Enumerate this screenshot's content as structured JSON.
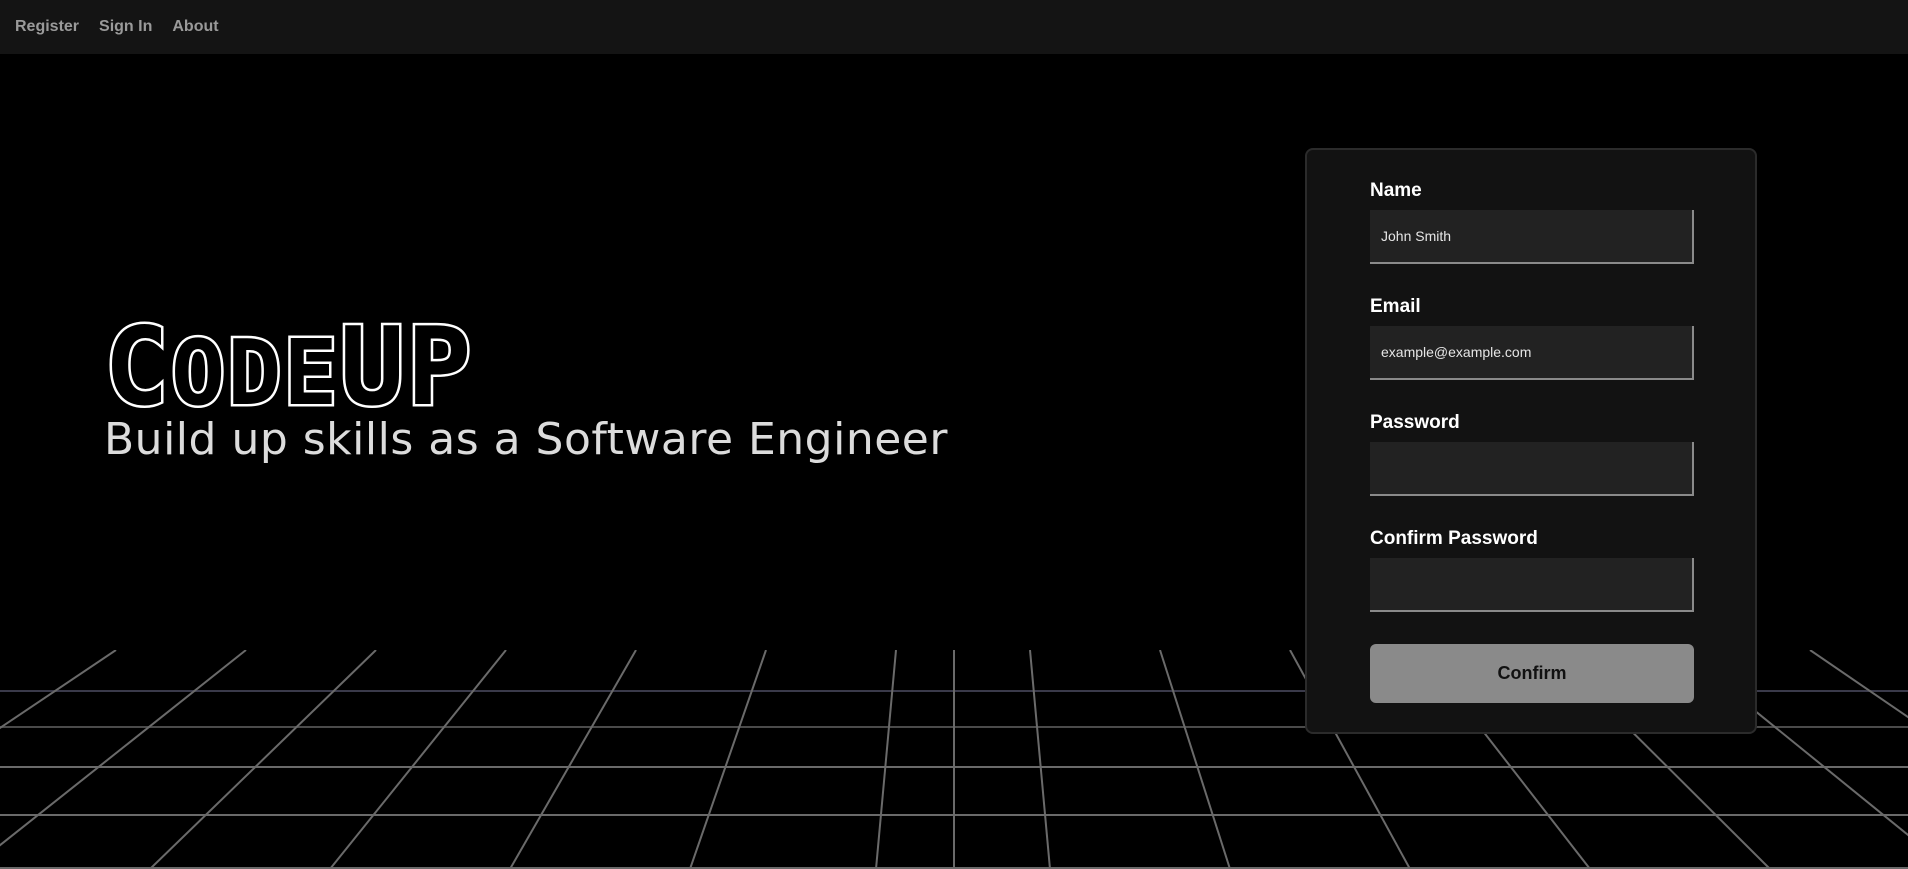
{
  "nav": {
    "items": [
      {
        "label": "Register"
      },
      {
        "label": "Sign In"
      },
      {
        "label": "About"
      }
    ]
  },
  "logo": {
    "title_first": "C",
    "title_rest": "ODE",
    "title_end": "UP",
    "subtitle": "Build up skills as a Software Engineer"
  },
  "form": {
    "name": {
      "label": "Name",
      "placeholder": "John Smith"
    },
    "email": {
      "label": "Email",
      "placeholder": "example@example.com"
    },
    "password": {
      "label": "Password",
      "placeholder": ""
    },
    "confirm_password": {
      "label": "Confirm Password",
      "placeholder": ""
    },
    "confirm_label": "Confirm"
  },
  "colors": {
    "background": "#000000",
    "navbar": "#141414",
    "card": "#121212",
    "input": "#222222",
    "button": "#8a8a8a"
  }
}
